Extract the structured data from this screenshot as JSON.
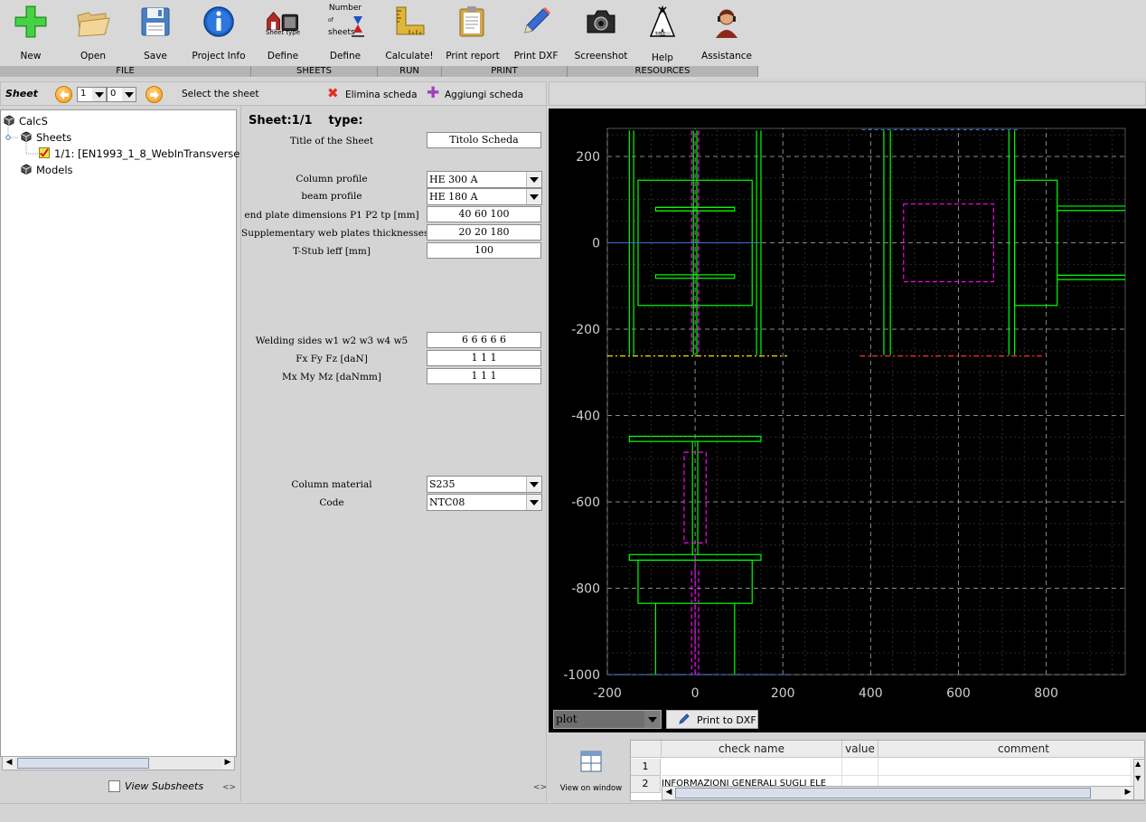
{
  "toolbar": {
    "buttons": [
      {
        "label": "New",
        "icon": "plus-icon"
      },
      {
        "label": "Open",
        "icon": "folder-open-icon"
      },
      {
        "label": "Save",
        "icon": "floppy-disk-icon"
      },
      {
        "label": "Project Info",
        "icon": "info-icon"
      },
      {
        "label": "Define",
        "icon": "sheet-type-icon",
        "caption": "Sheet type"
      },
      {
        "label": "Define",
        "icon": "number-of-sheets-icon",
        "caption": "Number of sheets"
      },
      {
        "label": "Calculate!",
        "icon": "ruler-icon"
      },
      {
        "label": "Print report",
        "icon": "clipboard-icon"
      },
      {
        "label": "Print DXF",
        "icon": "pencil-icon"
      },
      {
        "label": "Screenshot",
        "icon": "camera-icon"
      },
      {
        "label": "Help",
        "icon": "help-tepee-icon"
      },
      {
        "label": "Assistance",
        "icon": "assistant-person-icon"
      }
    ],
    "sheet_type_caption": "Sheet type",
    "number_caption_1": "Number",
    "number_caption_2": "of",
    "number_caption_3": "sheets",
    "groups": [
      "FILE",
      "SHEETS",
      "RUN",
      "PRINT",
      "RESOURCES"
    ]
  },
  "sheetbar": {
    "title": "Sheet",
    "sheet_index": "1",
    "sub_index": "0",
    "select_label": "Select the sheet",
    "delete_label": "Elimina scheda",
    "add_label": "Aggiungi scheda"
  },
  "tree": {
    "root": "CalcS",
    "sheets": "Sheets",
    "sheet_item": "1/1: [EN1993_1_8_WebInTransverse",
    "models": "Models"
  },
  "view_subsheets": "View Subsheets",
  "form": {
    "heading": "Sheet:1/1",
    "type_label": "type:",
    "title_label": "Title of the Sheet",
    "title_value": "Titolo Scheda",
    "column_profile_label": "Column profile",
    "column_profile_value": "HE 300 A",
    "beam_profile_label": "beam profile",
    "beam_profile_value": "HE 180 A",
    "end_plate_label": "end plate dimensions P1 P2 tp [mm]",
    "end_plate_value": "40 60 100",
    "web_plates_label": "Supplementary web plates thicknesses:",
    "web_plates_value": "20 20 180",
    "tstub_label": "T-Stub leff [mm]",
    "tstub_value": "100",
    "welding_label": "Welding sides w1 w2 w3 w4 w5",
    "welding_value": "6 6 6 6 6",
    "forces_label": "Fx Fy Fz [daN]",
    "forces_value": "1 1 1",
    "moments_label": "Mx My Mz [daNmm]",
    "moments_value": "1 1 1",
    "material_label": "Column material",
    "material_value": "S235",
    "code_label": "Code",
    "code_value": "NTC08"
  },
  "plot": {
    "x_ticks": [
      "-200",
      "0",
      "200",
      "400",
      "600",
      "800"
    ],
    "y_ticks": [
      "200",
      "0",
      "-200",
      "-400",
      "-600",
      "-800",
      "-1000"
    ],
    "xlim": [
      -200,
      980
    ],
    "ylim": [
      -1000,
      265
    ],
    "combo_value": "plot",
    "dxf_button": "Print to DXF"
  },
  "checks": {
    "view_on_window": "View on window",
    "columns": [
      "check name",
      "value",
      "comment"
    ],
    "rows": [
      {
        "n": "1",
        "name": "",
        "value": "",
        "comment": ""
      },
      {
        "n": "2",
        "name": "INFORMAZIONI GENERALI SUGLI ELE",
        "value": "",
        "comment": ""
      }
    ]
  },
  "colors": {
    "accent_green": "#00ff00",
    "magenta": "#ff00ff",
    "yellow": "#ffd700",
    "red": "#ff3030",
    "blue": "#3a6fd8"
  }
}
